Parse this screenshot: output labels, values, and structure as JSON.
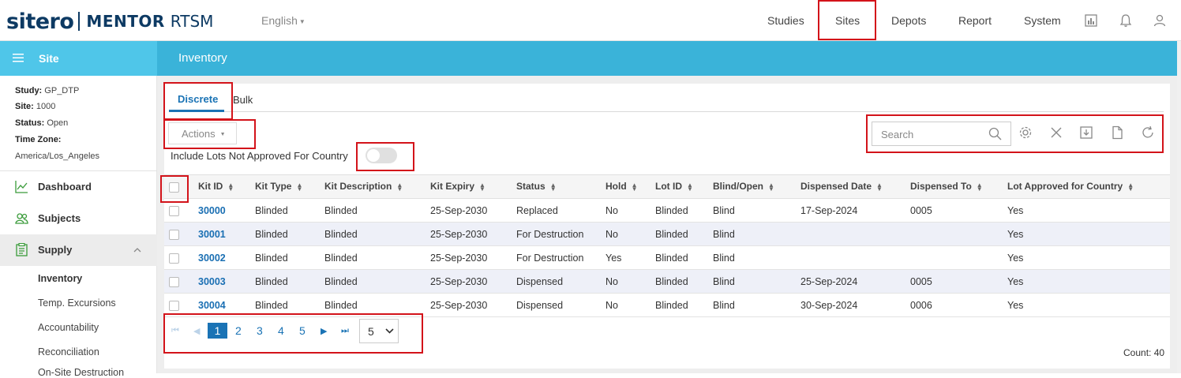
{
  "header": {
    "logo_sitero": "sitero",
    "logo_mentor": "MENTOR",
    "logo_rtsm": "RTSM",
    "language": "English",
    "nav": [
      "Studies",
      "Sites",
      "Depots",
      "Report",
      "System"
    ],
    "icons": [
      "chart-icon",
      "bell-icon",
      "user-icon"
    ]
  },
  "sidebar": {
    "title": "Site",
    "info": {
      "study_label": "Study:",
      "study": "GP_DTP",
      "site_label": "Site:",
      "site": "1000",
      "status_label": "Status:",
      "status": "Open",
      "tz_label": "Time Zone:",
      "tz": "America/Los_Angeles"
    },
    "items": [
      {
        "label": "Dashboard",
        "icon": "dashboard-icon"
      },
      {
        "label": "Subjects",
        "icon": "subjects-icon"
      },
      {
        "label": "Supply",
        "icon": "supply-icon"
      }
    ],
    "sub_items": [
      "Inventory",
      "Temp. Excursions",
      "Accountability",
      "Reconciliation",
      "On-Site Destruction"
    ]
  },
  "page": {
    "title": "Inventory",
    "tabs": [
      "Discrete",
      "Bulk"
    ],
    "actions_label": "Actions",
    "toggle_label": "Include Lots Not Approved For Country",
    "toggle_on": false,
    "search_placeholder": "Search",
    "toolbar_icons": [
      "settings-icon",
      "clear-icon",
      "download-icon",
      "document-icon",
      "refresh-icon"
    ]
  },
  "table": {
    "columns": [
      "Kit ID",
      "Kit Type",
      "Kit Description",
      "Kit Expiry",
      "Status",
      "Hold",
      "Lot ID",
      "Blind/Open",
      "Dispensed Date",
      "Dispensed To",
      "Lot Approved for Country"
    ],
    "rows": [
      [
        "30000",
        "Blinded",
        "Blinded",
        "25-Sep-2030",
        "Replaced",
        "No",
        "Blinded",
        "Blind",
        "17-Sep-2024",
        "0005",
        "Yes"
      ],
      [
        "30001",
        "Blinded",
        "Blinded",
        "25-Sep-2030",
        "For Destruction",
        "No",
        "Blinded",
        "Blind",
        "",
        "",
        "Yes"
      ],
      [
        "30002",
        "Blinded",
        "Blinded",
        "25-Sep-2030",
        "For Destruction",
        "Yes",
        "Blinded",
        "Blind",
        "",
        "",
        "Yes"
      ],
      [
        "30003",
        "Blinded",
        "Blinded",
        "25-Sep-2030",
        "Dispensed",
        "No",
        "Blinded",
        "Blind",
        "25-Sep-2024",
        "0005",
        "Yes"
      ],
      [
        "30004",
        "Blinded",
        "Blinded",
        "25-Sep-2030",
        "Dispensed",
        "No",
        "Blinded",
        "Blind",
        "30-Sep-2024",
        "0006",
        "Yes"
      ]
    ]
  },
  "pager": {
    "pages": [
      "1",
      "2",
      "3",
      "4",
      "5"
    ],
    "current": "1",
    "page_size": "5",
    "count_text": "Count: 40"
  },
  "colors": {
    "accent": "#1a73b5",
    "header_bar": "#3ab3d9",
    "sidebar_head": "#4fc6e9",
    "highlight": "#d3131a"
  }
}
